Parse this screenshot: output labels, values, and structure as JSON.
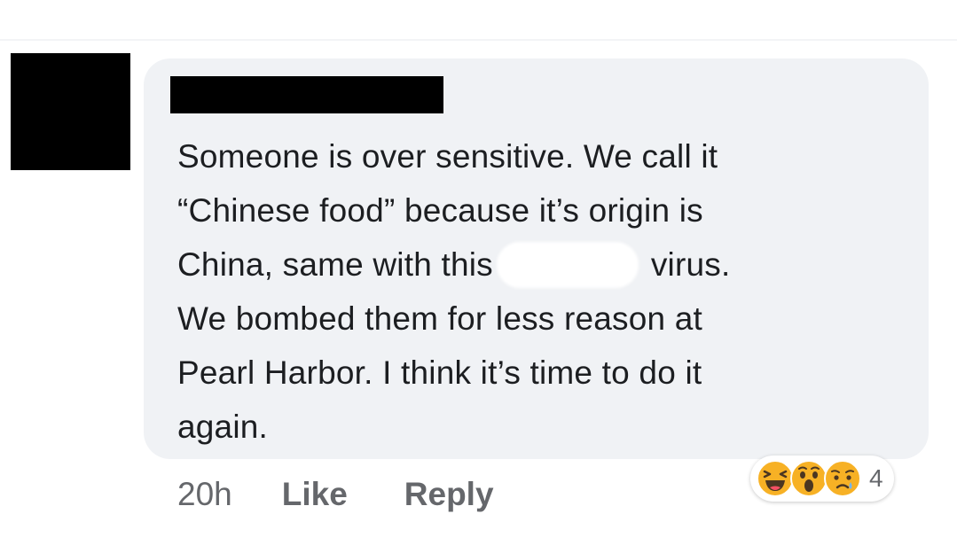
{
  "comment": {
    "lines": [
      "Someone is over sensitive. We call it",
      "“Chinese food” because it’s origin is",
      "China, same with this",
      "virus.",
      "We bombed them for less reason at",
      "Pearl Harbor. I think it’s time to do it",
      "again."
    ]
  },
  "actions": {
    "timestamp": "20h",
    "like_label": "Like",
    "reply_label": "Reply"
  },
  "reactions": {
    "icons": [
      "haha-reaction-icon",
      "wow-reaction-icon",
      "sad-reaction-icon"
    ],
    "count": "4"
  },
  "colors": {
    "bubble": "#f0f2f5",
    "text": "#1c1e21",
    "secondary_text": "#65676b",
    "reaction_yellow": "#f7b125"
  }
}
